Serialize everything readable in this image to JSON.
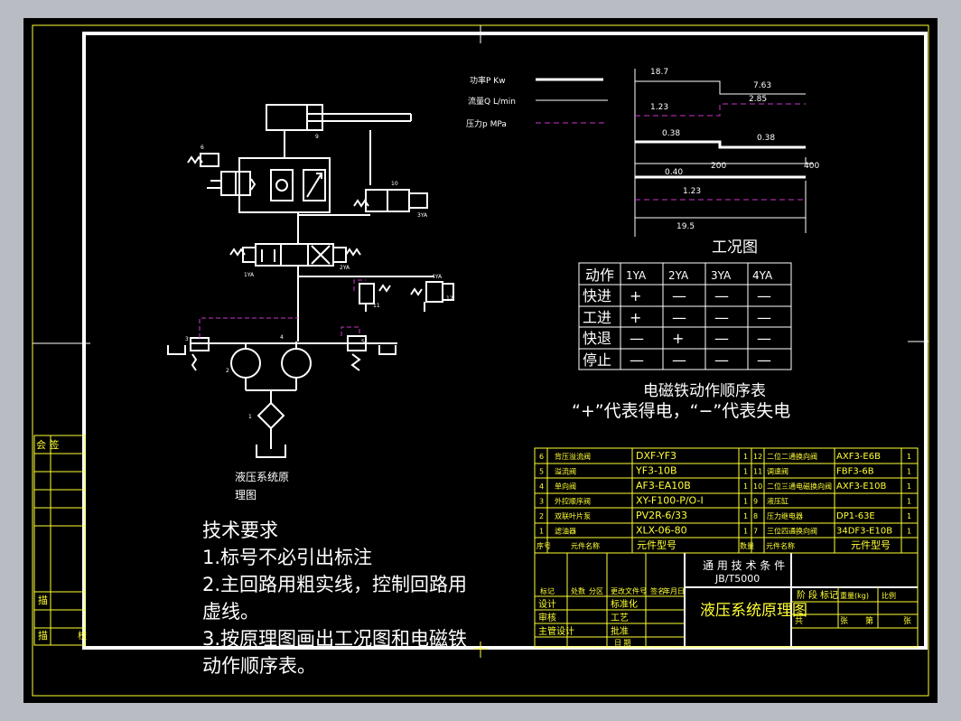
{
  "colors": {
    "background": "#000000",
    "frame": "#ffff33",
    "line": "#ffffff",
    "dashed": "#cc33cc",
    "page": "#b9bcc3"
  },
  "left_strip": {
    "sign_top": "会 签",
    "desc_a": "描",
    "desc_b": "描",
    "desc_code": "校"
  },
  "legend": {
    "power": "功率P Kw",
    "flow": "流量Q L/min",
    "pressure": "压力p MPa"
  },
  "work_chart": {
    "title": "工况图",
    "values": [
      "18.7",
      "7.63",
      "2.85",
      "1.23",
      "0.38",
      "0.38",
      "0.40",
      "200",
      "400",
      "1.23",
      "19.5"
    ]
  },
  "action_table": {
    "header": [
      "动作",
      "1YA",
      "2YA",
      "3YA",
      "4YA"
    ],
    "rows": [
      [
        "快进",
        "+",
        "—",
        "—",
        "—"
      ],
      [
        "工进",
        "+",
        "—",
        "—",
        "—"
      ],
      [
        "快退",
        "—",
        "+",
        "—",
        "—"
      ],
      [
        "停止",
        "—",
        "—",
        "—",
        "—"
      ]
    ],
    "caption": "电磁铁动作顺序表",
    "note": "“+”代表得电，“−”代表失电"
  },
  "hydraulic": {
    "caption_line1": "液压系统原",
    "caption_line2": "理图",
    "labels": [
      "1",
      "2",
      "3",
      "4",
      "5",
      "6",
      "7",
      "8",
      "9",
      "10",
      "11",
      "12",
      "1YA",
      "2YA",
      "3YA",
      "4YA"
    ]
  },
  "requirements": {
    "title": "技术要求",
    "items": [
      "1.标号不必引出标注",
      "2.主回路用粗实线，控制回路用虚线。",
      "3.按原理图画出工况图和电磁铁动作顺序表。"
    ]
  },
  "parts_list": {
    "left": [
      [
        "6",
        "背压溢流阀",
        "DXF-YF3",
        "1"
      ],
      [
        "5",
        "溢流阀",
        "YF3-10B",
        "1"
      ],
      [
        "4",
        "单向阀",
        "AF3-EA10B",
        "1"
      ],
      [
        "3",
        "外控顺序阀",
        "XY-F100-P/O-I",
        "1"
      ],
      [
        "2",
        "双联叶片泵",
        "PV2R-6/33",
        "1"
      ],
      [
        "1",
        "滤油器",
        "XLX-06-80",
        "1"
      ]
    ],
    "right": [
      [
        "12",
        "二位二通换向阀",
        "AXF3-E6B",
        "1"
      ],
      [
        "11",
        "调速阀",
        "FBF3-6B",
        "1"
      ],
      [
        "10",
        "二位三通电磁换向阀",
        "AXF3-E10B",
        "1"
      ],
      [
        "9",
        "液压缸",
        "",
        "1"
      ],
      [
        "8",
        "压力继电器",
        "DP1-63E",
        "1"
      ],
      [
        "7",
        "三位四通换向阀",
        "34DF3-E10B",
        "1"
      ]
    ],
    "footer": [
      "序号",
      "元件名称",
      "元件型号",
      "数量"
    ]
  },
  "title_block": {
    "std_label": "通 用 技 术 条 件",
    "std": "JB/T5000",
    "drawing_title": "液压系统原理图",
    "marks": [
      "标记",
      "处数",
      "分区",
      "更改文件号",
      "签名",
      "年月日"
    ],
    "roles": [
      "设计",
      "标准化",
      "审核",
      "工艺",
      "主管设计",
      "批准"
    ],
    "stage": [
      "阶",
      "段",
      "标",
      "记"
    ],
    "sheet": [
      "共",
      "张",
      "第",
      "张"
    ],
    "scale_weight": [
      "重量(kg)",
      "比例"
    ],
    "date_label": "日 期"
  }
}
